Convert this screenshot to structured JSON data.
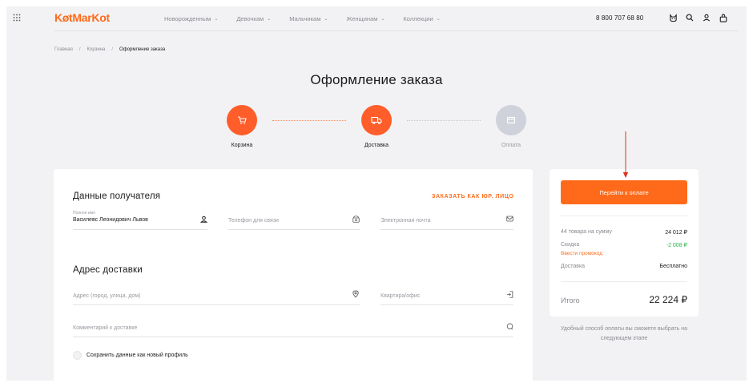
{
  "header": {
    "logo": "KøtMarKot",
    "nav": [
      {
        "label": "Новорожденным"
      },
      {
        "label": "Девочкам"
      },
      {
        "label": "Мальчикам"
      },
      {
        "label": "Женщинам"
      },
      {
        "label": "Коллекции"
      }
    ],
    "phone": "8 800 707 68 80",
    "icons": [
      "grid-icon",
      "cat-icon",
      "search-icon",
      "user-icon",
      "cart-icon"
    ]
  },
  "breadcrumb": {
    "items": [
      "Главная",
      "Корзина",
      "Оформление заказа"
    ],
    "separator": "/"
  },
  "page_title": "Оформление заказа",
  "steps": [
    {
      "label": "Корзина",
      "icon": "cart-icon",
      "state": "active"
    },
    {
      "label": "Доставка",
      "icon": "truck-icon",
      "state": "active"
    },
    {
      "label": "Оплата",
      "icon": "wallet-icon",
      "state": "inactive"
    }
  ],
  "recipient": {
    "title": "Данные получателя",
    "legal_link": "ЗАКАЗАТЬ КАК ЮР. ЛИЦО",
    "full_name_label": "Полное имя",
    "full_name_value": "Василевс Леонидович Львов",
    "phone_placeholder": "Телефон для связи",
    "email_placeholder": "Электронная почта"
  },
  "delivery": {
    "title": "Адрес доставки",
    "address_placeholder": "Адрес (город, улица, дом)",
    "apartment_placeholder": "Квартира/офис",
    "comment_placeholder": "Комментарий к доставке",
    "save_profile_label": "Сохранить данные как новый профиль"
  },
  "summary": {
    "pay_button": "Перейти к оплате",
    "items_label": "44 товара на сумму",
    "items_value": "24 012 ₽",
    "discount_label": "Скидка",
    "discount_value": "-2 008 ₽",
    "promo_link": "Ввести промокод",
    "delivery_label": "Доставка",
    "delivery_value": "Бесплатно",
    "total_label": "Итого",
    "total_value": "22 224 ₽",
    "note": "Удобный способ оплаты вы сможете выбрать на следующем этапе"
  },
  "colors": {
    "accent": "#ff6a1a",
    "step_active": "#ff5d2a",
    "step_inactive": "#cfd1db",
    "discount": "#2bb24c",
    "arrow": "#e0301e"
  }
}
